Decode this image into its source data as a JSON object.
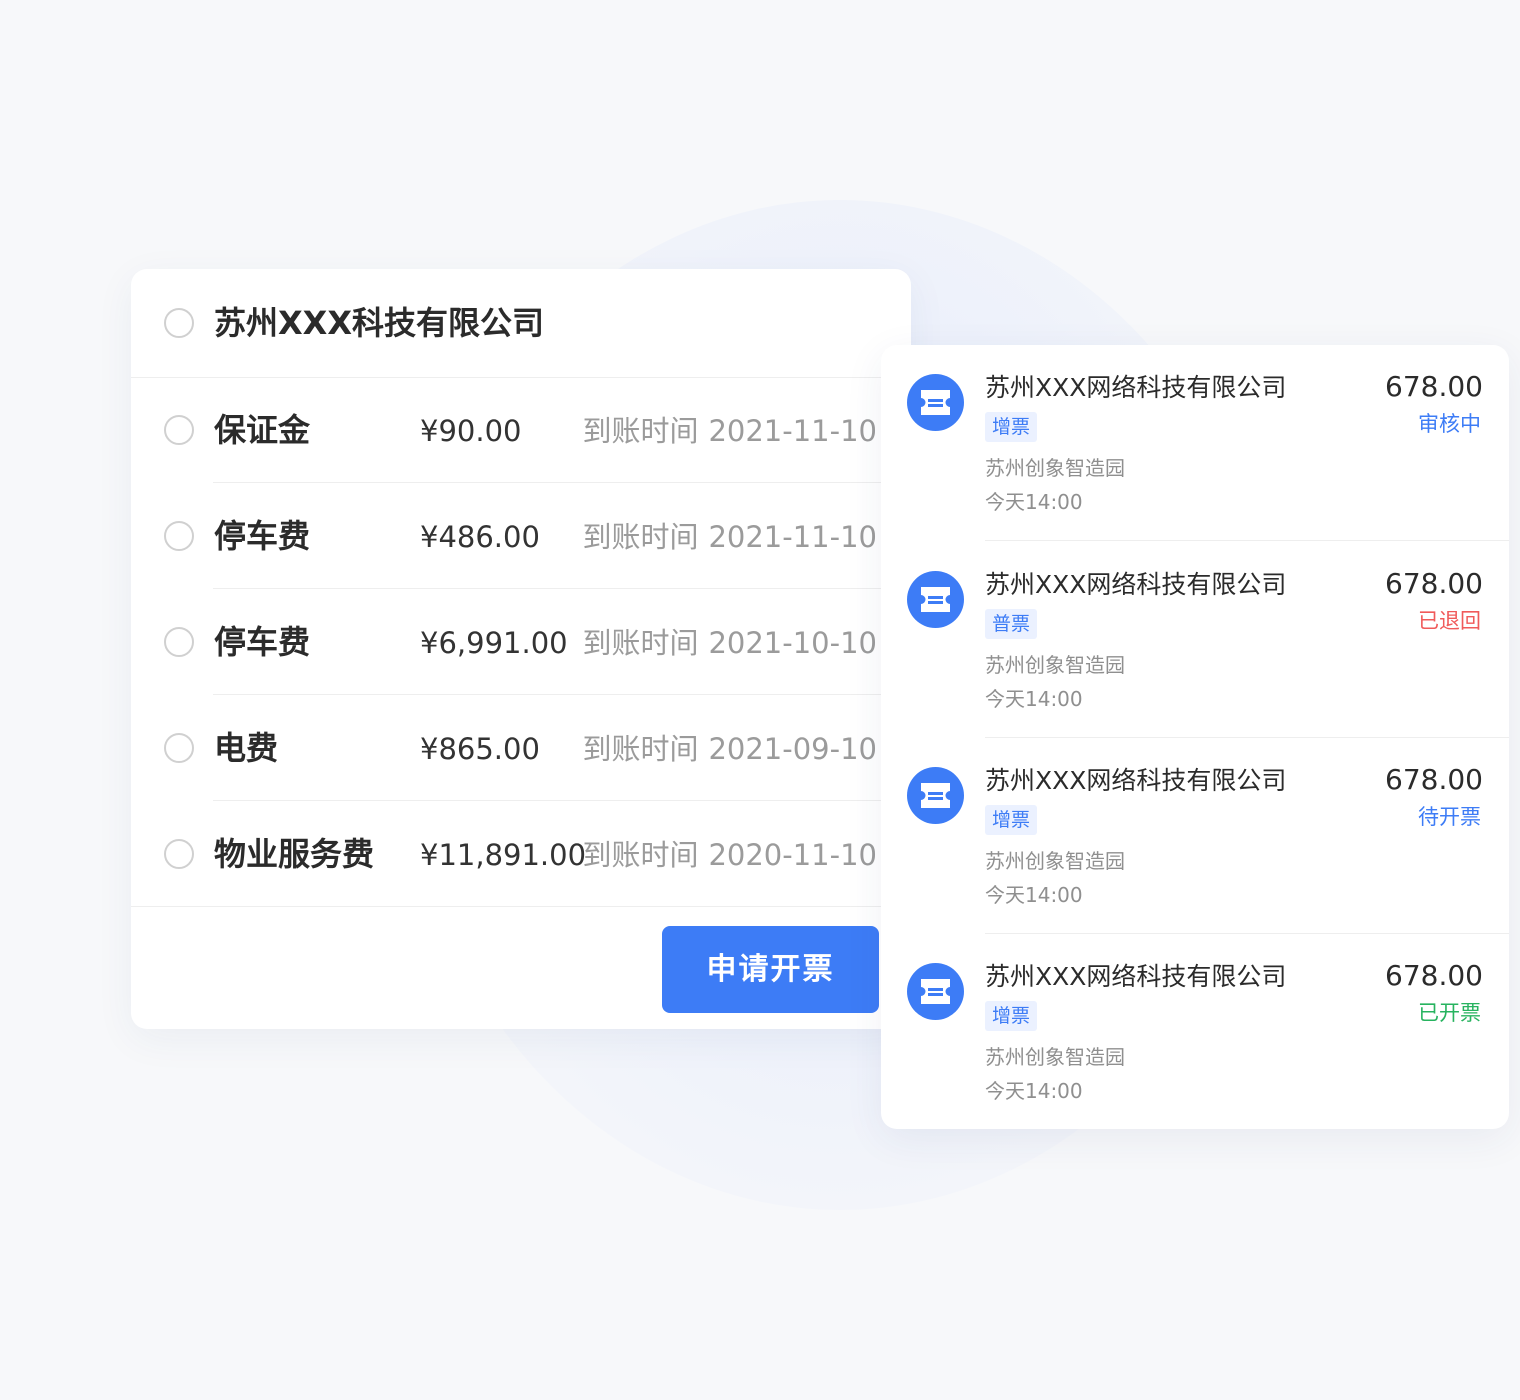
{
  "billing_card": {
    "company_name": "苏州XXX科技有限公司",
    "fees": [
      {
        "name": "保证金",
        "amount": "¥90.00",
        "time_label": "到账时间",
        "date": "2021-11-10"
      },
      {
        "name": "停车费",
        "amount": "¥486.00",
        "time_label": "到账时间",
        "date": "2021-11-10"
      },
      {
        "name": "停车费",
        "amount": "¥6,991.00",
        "time_label": "到账时间",
        "date": "2021-10-10"
      },
      {
        "name": "电费",
        "amount": "¥865.00",
        "time_label": "到账时间",
        "date": "2021-09-10"
      },
      {
        "name": "物业服务费",
        "amount": "¥11,891.00",
        "time_label": "到账时间",
        "date": "2020-11-10"
      }
    ],
    "apply_button_label": "申请开票"
  },
  "invoice_list": {
    "items": [
      {
        "icon": "ticket-icon",
        "company": "苏州XXX网络科技有限公司",
        "tag": "增票",
        "location": "苏州创象智造园",
        "time": "今天14:00",
        "amount": "678.00",
        "status": "审核中",
        "status_color": "#3d7cf6"
      },
      {
        "icon": "ticket-icon",
        "company": "苏州XXX网络科技有限公司",
        "tag": "普票",
        "location": "苏州创象智造园",
        "time": "今天14:00",
        "amount": "678.00",
        "status": "已退回",
        "status_color": "#f05a5a"
      },
      {
        "icon": "ticket-icon",
        "company": "苏州XXX网络科技有限公司",
        "tag": "增票",
        "location": "苏州创象智造园",
        "time": "今天14:00",
        "amount": "678.00",
        "status": "待开票",
        "status_color": "#3d7cf6"
      },
      {
        "icon": "ticket-icon",
        "company": "苏州XXX网络科技有限公司",
        "tag": "增票",
        "location": "苏州创象智造园",
        "time": "今天14:00",
        "amount": "678.00",
        "status": "已开票",
        "status_color": "#27b35f"
      }
    ]
  },
  "colors": {
    "accent": "#3d7cf6",
    "tag_background": "#ebf1ff",
    "page_background": "#f7f8fa"
  }
}
